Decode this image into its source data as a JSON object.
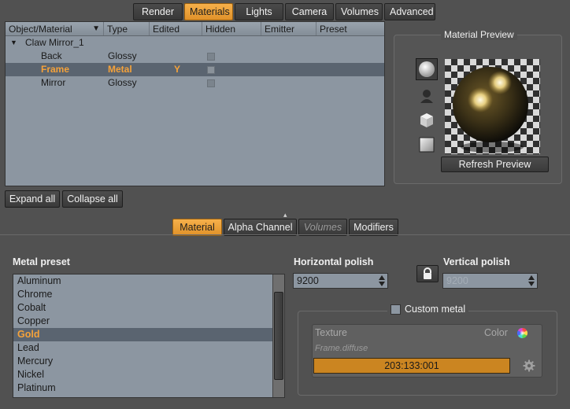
{
  "top_tabs": [
    "Render",
    "Materials",
    "Lights",
    "Camera",
    "Volumes",
    "Advanced"
  ],
  "active_top_tab": "Materials",
  "tree": {
    "columns": [
      "Object/Material",
      "Type",
      "Edited",
      "Hidden",
      "Emitter",
      "Preset"
    ],
    "root": "Claw Mirror_1",
    "rows": [
      {
        "name": "Back",
        "type": "Glossy",
        "edited": ""
      },
      {
        "name": "Frame",
        "type": "Metal",
        "edited": "Y"
      },
      {
        "name": "Mirror",
        "type": "Glossy",
        "edited": ""
      }
    ]
  },
  "buttons": {
    "expand_all": "Expand all",
    "collapse_all": "Collapse all",
    "refresh_preview": "Refresh Preview"
  },
  "material_preview": {
    "title": "Material Preview",
    "shapes": [
      "sphere-icon",
      "figure-icon",
      "cube-icon",
      "plane-icon"
    ]
  },
  "sub_tabs": [
    "Material",
    "Alpha Channel",
    "Volumes",
    "Modifiers"
  ],
  "active_sub_tab": "Material",
  "metal_preset": {
    "label": "Metal preset",
    "items": [
      "Aluminum",
      "Chrome",
      "Cobalt",
      "Copper",
      "Gold",
      "Lead",
      "Mercury",
      "Nickel",
      "Platinum"
    ],
    "selected": "Gold"
  },
  "horizontal_polish": {
    "label": "Horizontal polish",
    "value": "9200"
  },
  "vertical_polish": {
    "label": "Vertical polish",
    "value": "9200"
  },
  "custom_metal": {
    "label": "Custom metal",
    "texture_label": "Texture",
    "color_label": "Color",
    "texture_path": "Frame.diffuse",
    "color_value": "203:133:001"
  },
  "colors": {
    "accent_orange": "#f5a23a",
    "custom_metal_color": "#cb8521",
    "panel_bg": "#515151",
    "list_bg": "#8c96a1"
  }
}
